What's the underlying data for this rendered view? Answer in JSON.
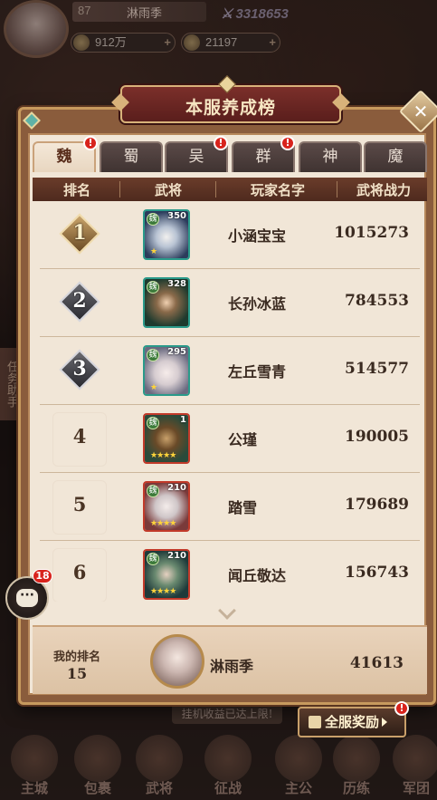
{
  "hud": {
    "level": "87",
    "player_name": "淋雨季",
    "combat_power": "3318653",
    "coins": "912万",
    "gems": "21197",
    "side_label": "任务助手"
  },
  "panel": {
    "title": "本服养成榜",
    "close_icon": "close-icon"
  },
  "tabs": [
    {
      "label": "魏",
      "active": true,
      "badge": true
    },
    {
      "label": "蜀",
      "active": false,
      "badge": false
    },
    {
      "label": "吴",
      "active": false,
      "badge": true
    },
    {
      "label": "群",
      "active": false,
      "badge": true
    },
    {
      "label": "神",
      "active": false,
      "badge": false
    },
    {
      "label": "魔",
      "active": false,
      "badge": false
    }
  ],
  "badge_mark": "!",
  "table": {
    "headers": [
      "排名",
      "武将",
      "玩家名字",
      "武将战力"
    ],
    "rows": [
      {
        "rank": "1",
        "emblem": "gold",
        "hero_level": "350",
        "hero_faction": "魏",
        "player": "小涵宝宝",
        "power": "1015273"
      },
      {
        "rank": "2",
        "emblem": "silver",
        "hero_level": "328",
        "hero_faction": "魏",
        "player": "长孙冰蓝",
        "power": "784553"
      },
      {
        "rank": "3",
        "emblem": "silver",
        "hero_level": "295",
        "hero_faction": "魏",
        "player": "左丘雪青",
        "power": "514577"
      },
      {
        "rank": "4",
        "emblem": "plain",
        "hero_level": "1",
        "hero_faction": "魏",
        "player": "公瑾",
        "power": "190005"
      },
      {
        "rank": "5",
        "emblem": "plain",
        "hero_level": "210",
        "hero_faction": "魏",
        "player": "踏雪",
        "power": "179689"
      },
      {
        "rank": "6",
        "emblem": "plain",
        "hero_level": "210",
        "hero_faction": "魏",
        "player": "闻丘敬达",
        "power": "156743"
      }
    ]
  },
  "my_rank": {
    "label": "我的排名",
    "rank": "15",
    "name": "淋雨季",
    "power": "41613"
  },
  "chat": {
    "unread": "18",
    "icon": "chat-bubble-icon"
  },
  "notice": "挂机收益已达上限!",
  "reward_button": {
    "label": "全服奖励"
  },
  "bottom_nav": [
    "主城",
    "包裹",
    "武将",
    "征战",
    "主公",
    "历练",
    "军团"
  ],
  "colors": {
    "panel_bg": "#f1e6d7",
    "header_bg": "#5a2e1c",
    "title_banner": "#6a2624",
    "badge_red": "#d8231c",
    "hero_frame_teal": "#2a9a8a",
    "hero_frame_red": "#c23a2a"
  }
}
